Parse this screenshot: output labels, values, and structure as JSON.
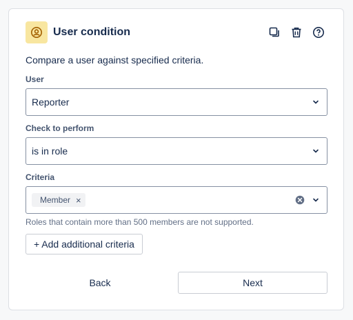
{
  "header": {
    "title": "User condition",
    "icon": "user-circle-icon",
    "icon_bg": "#f8e6a0",
    "icon_color": "#a35f00",
    "actions": [
      "duplicate-icon",
      "trash-icon",
      "help-icon"
    ]
  },
  "description": "Compare a user against specified criteria.",
  "fields": {
    "user": {
      "label": "User",
      "value": "Reporter"
    },
    "check": {
      "label": "Check to perform",
      "value": "is in role"
    },
    "criteria": {
      "label": "Criteria",
      "tags": [
        "Member"
      ],
      "helper": "Roles that contain more than 500 members are not supported."
    }
  },
  "buttons": {
    "add_criteria": "+ Add additional criteria",
    "back": "Back",
    "next": "Next"
  }
}
